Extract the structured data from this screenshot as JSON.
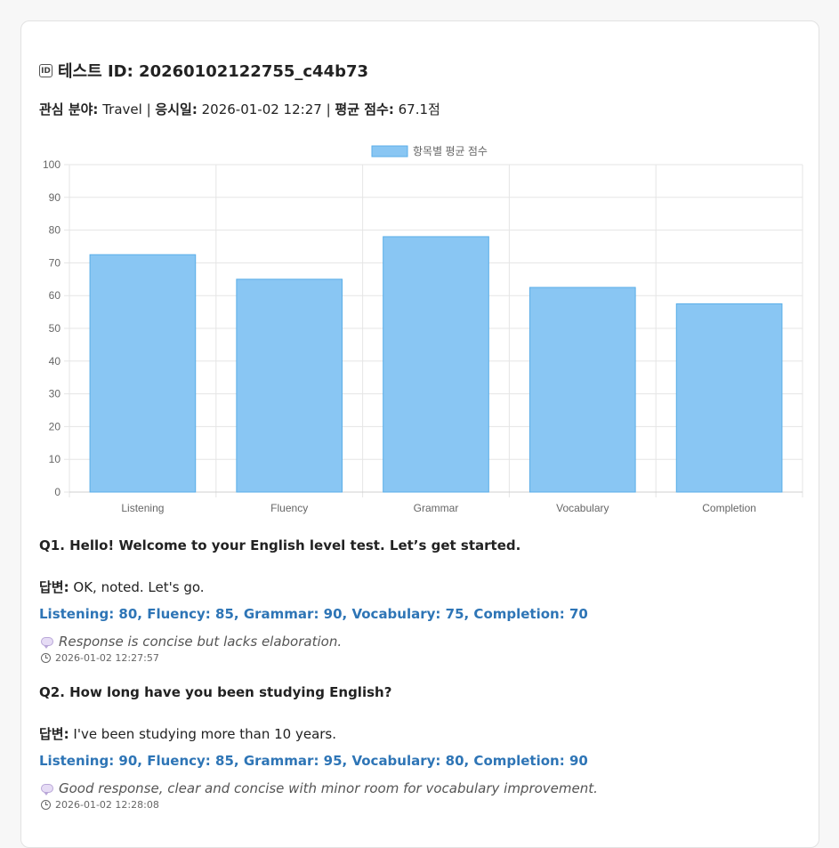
{
  "header": {
    "title": "테스트 ID: 20260102122755_c44b73",
    "id_icon": "ID"
  },
  "meta": {
    "interest_label": "관심 분야:",
    "interest_value": "Travel",
    "sep1": "|",
    "date_label": "응시일:",
    "date_value": "2026-01-02 12:27",
    "sep2": "|",
    "avg_label": "평균 점수:",
    "avg_value": "67.1점"
  },
  "chart_data": {
    "type": "bar",
    "categories": [
      "Listening",
      "Fluency",
      "Grammar",
      "Vocabulary",
      "Completion"
    ],
    "series": [
      {
        "name": "항목별 평균 점수",
        "values": [
          72.5,
          65,
          78,
          62.5,
          57.5
        ]
      }
    ],
    "ylim": [
      0,
      100
    ],
    "yticks": [
      0,
      10,
      20,
      30,
      40,
      50,
      60,
      70,
      80,
      90,
      100
    ],
    "grid": true,
    "legend": "top-center",
    "bar_fill": "#89c6f3",
    "bar_stroke": "#5aaee8"
  },
  "questions": [
    {
      "question": "Q1. Hello! Welcome to your English level test. Let’s get started.",
      "answer_label": "답변:",
      "answer": "OK, noted. Let's go.",
      "scores": "Listening: 80, Fluency: 85, Grammar: 90, Vocabulary: 75, Completion: 70",
      "feedback": "Response is concise but lacks elaboration.",
      "timestamp": "2026-01-02 12:27:57"
    },
    {
      "question": "Q2. How long have you been studying English?",
      "answer_label": "답변:",
      "answer": "I've been studying more than 10 years.",
      "scores": "Listening: 90, Fluency: 85, Grammar: 95, Vocabulary: 80, Completion: 90",
      "feedback": "Good response, clear and concise with minor room for vocabulary improvement.",
      "timestamp": "2026-01-02 12:28:08"
    }
  ],
  "colors": {
    "score_text": "#2e75b6",
    "card_border": "#e2e2e2"
  },
  "icons": {
    "feedback": "speech-bubble-icon",
    "timestamp": "clock-icon",
    "title": "id-badge-icon"
  }
}
